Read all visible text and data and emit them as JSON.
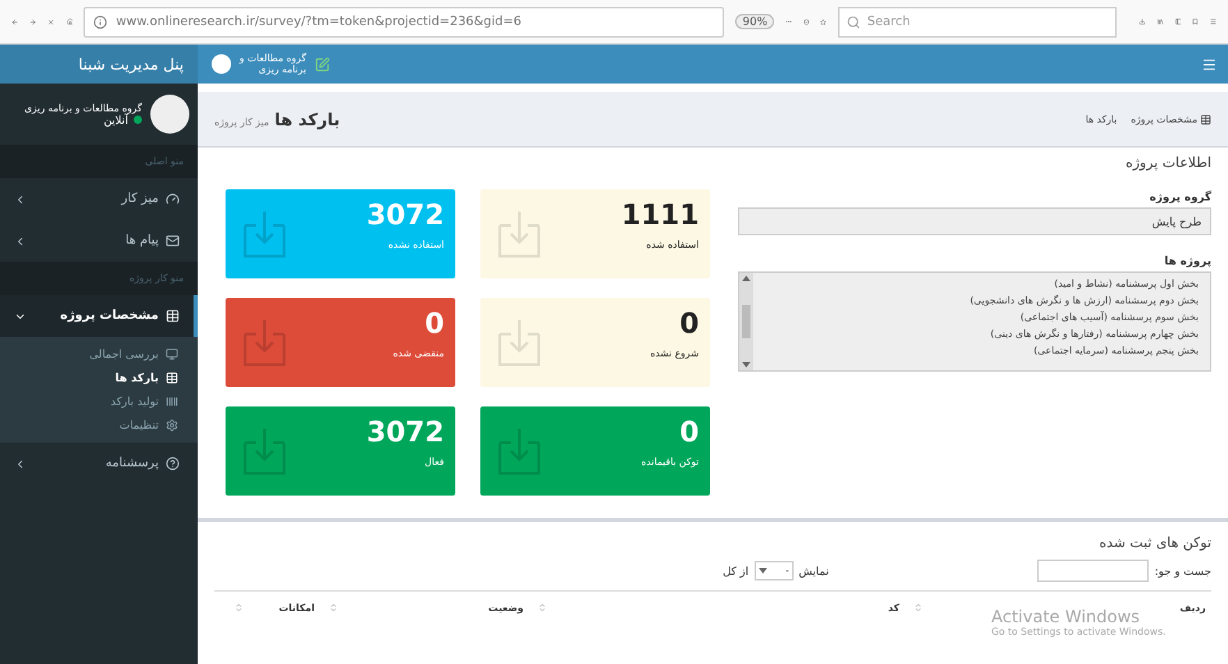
{
  "browser": {
    "url": "www.onlineresearch.ir/survey/?tm=token&projectid=236&gid=6",
    "zoom": "90%",
    "search": {
      "placeholder": "Search"
    }
  },
  "navbar": {
    "org_line_1": "گروه مطالعات و",
    "org_line_2": "برنامه ریزی"
  },
  "sidebar": {
    "brand": "پنل مدیریت شبنا",
    "user": {
      "name": "گروه مطالعات و برنامه ریزی",
      "status": "آنلاین"
    },
    "items": [
      {
        "kind": "header",
        "label": "منو اصلی"
      },
      {
        "kind": "link",
        "label": "میز کار",
        "expanded": false
      },
      {
        "kind": "link",
        "label": "پیام ها",
        "expanded": false
      },
      {
        "kind": "header",
        "label": "منو کار پروژه"
      },
      {
        "kind": "link",
        "label": "مشخصات پروژه",
        "expanded": true,
        "children": [
          {
            "label": "بررسی اجمالی",
            "selected": false
          },
          {
            "label": "بارکد ها",
            "selected": true
          },
          {
            "label": "تولید بارکد",
            "selected": false
          },
          {
            "label": "تنظیمات",
            "selected": false
          }
        ]
      },
      {
        "kind": "link",
        "label": "پرسشنامه",
        "expanded": false
      }
    ]
  },
  "content_header": {
    "title": "بارکد ها",
    "subtitle": "میز کار پروژه",
    "breadcrumb": [
      "مشخصات پروژه",
      "بارکد ها"
    ]
  },
  "project_info": {
    "title": "اطلاعات پروژه",
    "group_label": "گروه پروژه",
    "group_value": "طرح پایش",
    "projects_label": "پروژه ها",
    "projects": [
      "بخش اول پرسشنامه (نشاط و امید)",
      "بخش دوم پرسشنامه (ارزش ها و نگرش های دانشجویی)",
      "بخش سوم پرسشنامه (آسیب های اجتماعی)",
      "بخش چهارم پرسشنامه (رفتارها و نگرش های دینی)",
      "بخش پنجم پرسشنامه (سرمایه اجتماعی)"
    ]
  },
  "stats": [
    {
      "value": "1111",
      "label": "استفاده شده",
      "color": "#fcf8e3"
    },
    {
      "value": "3072",
      "label": "استفاده نشده",
      "color": "#00c0ef"
    },
    {
      "value": "0",
      "label": "شروع نشده",
      "color": "#fcf8e3"
    },
    {
      "value": "0",
      "label": "منقضی شده",
      "color": "#dd4b39"
    },
    {
      "value": "0",
      "label": "توکن باقیمانده",
      "color": "#00a65a"
    },
    {
      "value": "3072",
      "label": "فعال",
      "color": "#00a65a"
    }
  ],
  "tokens": {
    "title": "توکن های ثبت شده",
    "search_label": "جست و جو:",
    "length_before": "نمایش",
    "length_value": "-",
    "length_after": "از کل",
    "columns": [
      "ردیف",
      "کد",
      "وضعیت",
      "امکانات"
    ]
  },
  "os_notice": {
    "title": "Activate Windows",
    "text": "Go to Settings to activate Windows."
  }
}
